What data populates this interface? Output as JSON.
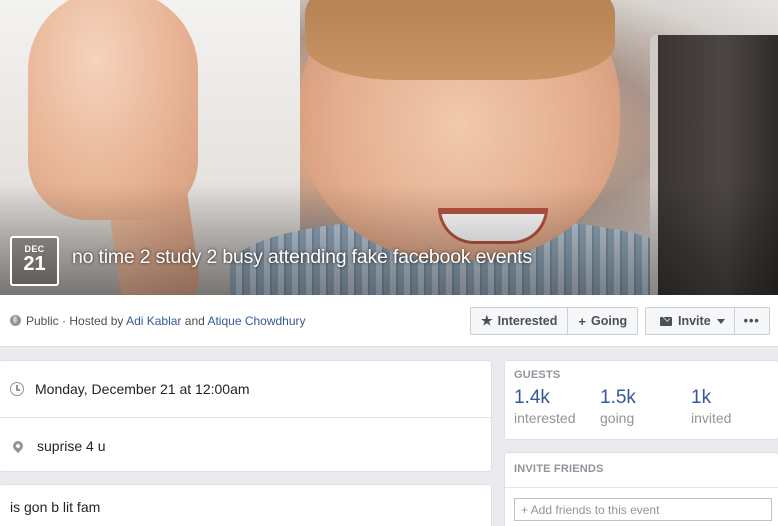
{
  "event": {
    "date_month": "DEC",
    "date_day": "21",
    "title": "no time 2 study 2 busy attending fake facebook events"
  },
  "host_line": {
    "privacy": "Public",
    "separator": " · Hosted by ",
    "host1": "Adi Kablar",
    "conjunction": " and ",
    "host2": "Atique Chowdhury"
  },
  "actions": {
    "interested_label": "Interested",
    "going_label": "Going",
    "invite_label": "Invite",
    "more_label": "•••"
  },
  "details": {
    "time": "Monday, December 21 at 12:00am",
    "location": "suprise 4 u",
    "description": "is gon b lit fam"
  },
  "guests": {
    "heading": "GUESTS",
    "stats": [
      {
        "value": "1.4k",
        "label": "interested"
      },
      {
        "value": "1.5k",
        "label": "going"
      },
      {
        "value": "1k",
        "label": "invited"
      }
    ]
  },
  "invite_friends": {
    "heading": "INVITE FRIENDS",
    "placeholder": "+ Add friends to this event"
  },
  "colors": {
    "link": "#365899",
    "background": "#e9ebee",
    "muted": "#90949c"
  }
}
